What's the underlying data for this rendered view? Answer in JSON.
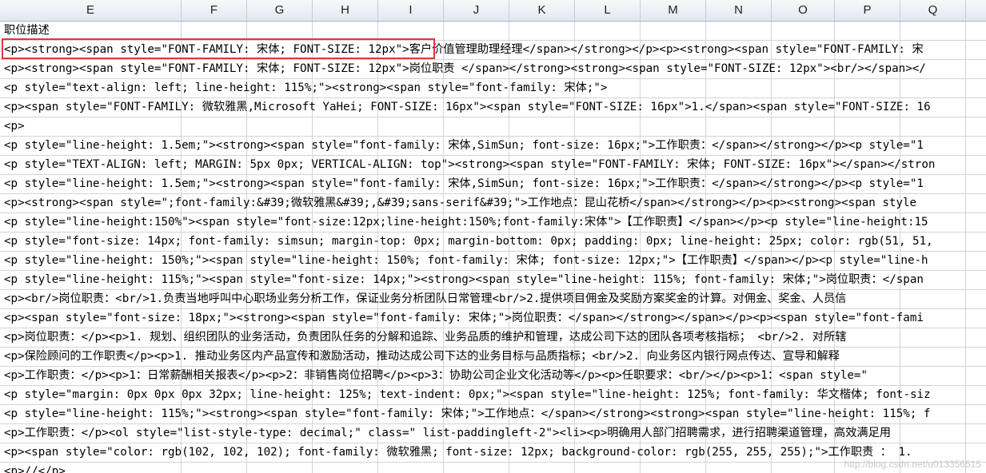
{
  "columns": [
    "E",
    "F",
    "G",
    "H",
    "I",
    "J",
    "K",
    "L",
    "M",
    "N",
    "O",
    "P",
    "Q"
  ],
  "rows": [
    "职位描述",
    "<p><strong><span style=\"FONT-FAMILY: 宋体; FONT-SIZE: 12px\">客户价值管理助理经理</span></strong></p><p><strong><span style=\"FONT-FAMILY: 宋",
    "<p><strong><span style=\"FONT-FAMILY: 宋体; FONT-SIZE: 12px\">岗位职责 </span></strong><strong><span style=\"FONT-SIZE: 12px\"><br/></span></",
    "<p style=\"text-align: left; line-height: 115%;\"><strong><span style=\"font-family: 宋体;\">",
    "<p><span style=\"FONT-FAMILY: 微软雅黑,Microsoft YaHei; FONT-SIZE: 16px\"><span style=\"FONT-SIZE: 16px\">1.</span><span style=\"FONT-SIZE: 16",
    "<p>",
    "<p style=\"line-height: 1.5em;\"><strong><span style=\"font-family: 宋体,SimSun; font-size: 16px;\">工作职责：</span></strong></p><p style=\"1",
    "<p style=\"TEXT-ALIGN: left; MARGIN: 5px 0px; VERTICAL-ALIGN: top\"><strong><span style=\"FONT-FAMILY: 宋体; FONT-SIZE: 16px\"></span></stron",
    "<p style=\"line-height: 1.5em;\"><strong><span style=\"font-family: 宋体,SimSun; font-size: 16px;\">工作职责：</span></strong></p><p style=\"1",
    "<p><strong><span style=\";font-family:&#39;微软雅黑&#39;,&#39;sans-serif&#39;\">工作地点：昆山花桥</span></strong></p><p><strong><span style",
    "<p style=\"line-height:150%\"><span style=\"font-size:12px;line-height:150%;font-family:宋体\">【工作职责】</span></p><p style=\"line-height:15",
    "<p style=\"font-size: 14px; font-family: simsun; margin-top: 0px; margin-bottom: 0px; padding: 0px; line-height: 25px; color: rgb(51, 51,",
    "<p style=\"line-height: 150%;\"><span style=\"line-height: 150%; font-family: 宋体; font-size: 12px;\">【工作职责】</span></p><p style=\"line-h",
    "<p style=\"line-height: 115%;\"><span style=\"font-size: 14px;\"><strong><span style=\"line-height: 115%; font-family: 宋体;\">岗位职责：</span",
    "<p><br/>岗位职责：<br/>1.负责当地呼叫中心职场业务分析工作，保证业务分析团队日常管理<br/>2.提供项目佣金及奖励方案奖金的计算。对佣金、奖金、人员信",
    "<p><span style=\"font-size: 18px;\"><strong><span style=\"font-family: 宋体;\">岗位职责：</span></strong></span></p><p><span style=\"font-fami",
    "<p>岗位职责：</p><p>1. 规划、组织团队的业务活动，负责团队任务的分解和追踪、业务品质的维护和管理，达成公司下达的团队各项考核指标； <br/>2. 对所辖",
    "<p>保险顾问的工作职责</p><p>1.  推动业务区内产品宣传和激励活动，推动达成公司下达的业务目标与品质指标；<br/>2.  向业务区内银行网点传达、宣导和解释",
    "<p>工作职责：</p><p>1：日常薪酬相关报表</p><p>2：非销售岗位招聘</p><p>3：协助公司企业文化活动等</p><p>任职要求：<br/></p><p>1：<span style=\"",
    "<p style=\"margin: 0px 0px 0px 32px; line-height: 125%; text-indent: 0px;\"><span style=\"line-height: 125%; font-family: 华文楷体; font-siz",
    "<p style=\"line-height: 115%;\"><strong><span style=\"font-family: 宋体;\">工作地点：</span></strong><strong><span style=\"line-height: 115%; f",
    "<p>工作职责：</p><ol style=\"list-style-type: decimal;\" class=\" list-paddingleft-2\"><li><p>明确用人部门招聘需求，进行招聘渠道管理，高效满足用",
    "<p><span style=\"color: rgb(102, 102, 102); font-family: 微软雅黑; font-size: 12px; background-color: rgb(255, 255, 255);\">工作职责 ： 1. ",
    "<p>//</p>"
  ],
  "watermark": "http://blog.csdn.net/u013356515"
}
